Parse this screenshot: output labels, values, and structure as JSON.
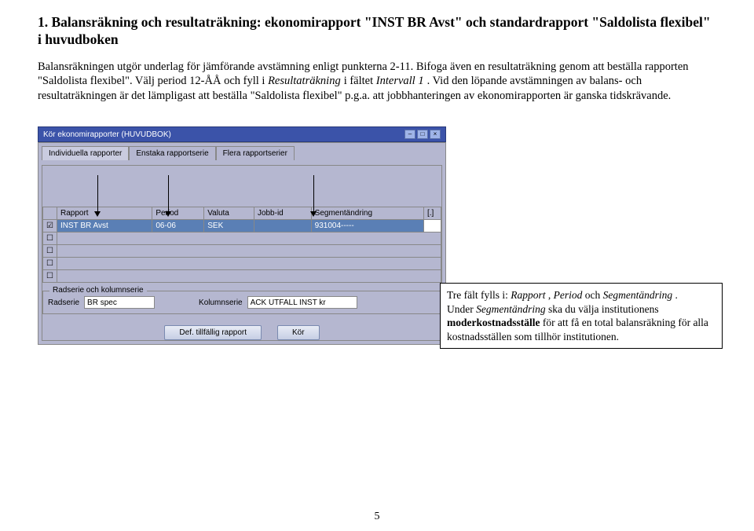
{
  "heading": "1. Balansräkning och resultaträkning: ekonomirapport \"INST BR Avst\" och standardrapport \"Saldolista flexibel\" i huvudboken",
  "para1_plain": "Balansräkningen utgör underlag för jämförande avstämning enligt punkterna 2-11. Bifoga även en resultaträkning genom att beställa rapporten \"Saldolista flexibel\". Välj period 12-ÅÅ och fyll i ",
  "para1_italic1": "Resultaträkning",
  "para1_mid": " i fältet ",
  "para1_italic2": "Intervall 1",
  "para1_end": ". Vid den löpande avstämningen av balans- och resultaträkningen är det lämpligast att beställa \"Saldolista flexibel\" p.g.a. att jobbhanteringen av ekonomirapporten är ganska tidskrävande.",
  "window_title": "Kör ekonomirapporter (HUVUDBOK)",
  "tabs": {
    "t0": "Individuella rapporter",
    "t1": "Enstaka rapportserie",
    "t2": "Flera rapportserier"
  },
  "grid_headers": {
    "check": "",
    "rapport": "Rapport",
    "period": "Period",
    "valuta": "Valuta",
    "jobbid": "Jobb-id",
    "segment": "Segmentändring",
    "extra": "[.]"
  },
  "grid_rows": {
    "r0": {
      "checked": "☑",
      "rapport": "INST BR Avst",
      "period": "06-06",
      "valuta": "SEK",
      "jobbid": "",
      "segment": "931004-----",
      "extra": ""
    }
  },
  "subpanel_title": "Radserie och kolumnserie",
  "radserie_label": "Radserie",
  "radserie_value": "BR spec",
  "kolumnserie_label": "Kolumnserie",
  "kolumnserie_value": "ACK UTFALL INST kr",
  "btn_def": "Def. tillfällig rapport",
  "btn_kor": "Kör",
  "callout_l1a": "Tre fält fylls i: ",
  "callout_l1_i1": "Rapport",
  "callout_l1b": ", ",
  "callout_l1_i2": "Period",
  "callout_l1c": " och ",
  "callout_l1_i3": "Segmentändring",
  "callout_l1d": ".",
  "callout_l2a": "Under ",
  "callout_l2_i": "Segmentändring",
  "callout_l2b": " ska du välja institutionens ",
  "callout_l3_bold": "moderkostnadsställe",
  "callout_l3_rest": " för att få en total balansräkning för alla kostnadsställen som tillhör institutionen.",
  "page_number": "5"
}
